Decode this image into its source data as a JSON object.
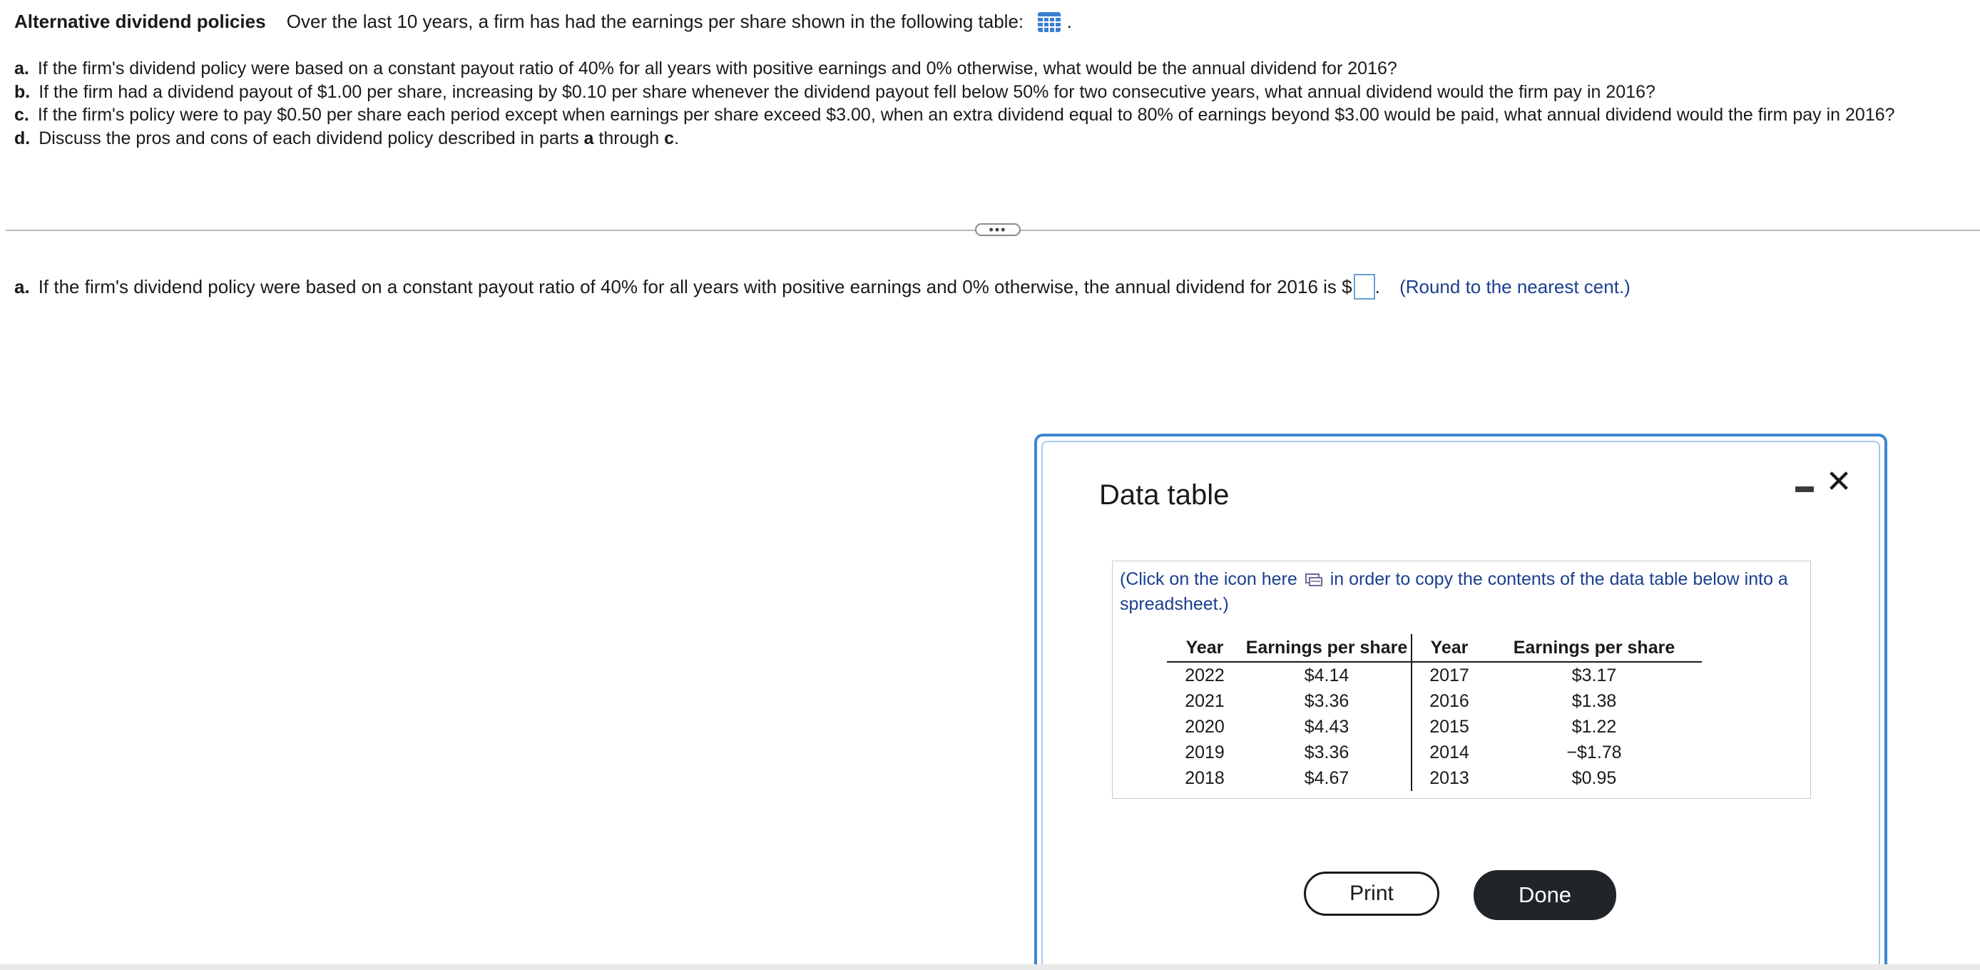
{
  "header": {
    "title": "Alternative dividend policies",
    "intro": "Over the last 10 years, a firm has had the earnings per share shown in the following table:",
    "trailing": "."
  },
  "questions": [
    {
      "letter": "a.",
      "text": "If the firm's dividend policy were based on a constant payout ratio of 40% for all years with positive earnings and 0% otherwise, what would be the annual dividend for 2016?"
    },
    {
      "letter": "b.",
      "text": "If the firm had a dividend payout of $1.00 per share, increasing by $0.10 per share whenever the dividend payout fell below 50% for two consecutive years, what annual dividend would the firm pay in 2016?"
    },
    {
      "letter": "c.",
      "text": "If the firm's policy were to pay $0.50 per share each period except when earnings per share exceed $3.00, when an extra dividend equal to 80% of earnings beyond $3.00 would be paid, what annual dividend would the firm pay in 2016?"
    },
    {
      "letter": "d.",
      "text_before": "Discuss the pros and cons of each dividend policy described in parts",
      "bold1": "a",
      "text_mid": "through",
      "bold2": "c",
      "text_after": "."
    }
  ],
  "expand_button": "•••",
  "answer": {
    "letter": "a.",
    "text": "If the firm's dividend policy were based on a constant payout ratio of 40% for all years with positive earnings and 0% otherwise, the annual dividend for 2016 is $",
    "value": "",
    "after": ".",
    "note": "(Round to the nearest cent.)"
  },
  "modal": {
    "title": "Data table",
    "copy_note_before": "(Click on the icon here",
    "copy_note_after": "in order to copy the contents of the data table below into a spreadsheet.)",
    "headers": [
      "Year",
      "Earnings per share",
      "Year",
      "Earnings per share"
    ],
    "rows": [
      [
        "2022",
        "$4.14",
        "2017",
        "$3.17"
      ],
      [
        "2021",
        "$3.36",
        "2016",
        "$1.38"
      ],
      [
        "2020",
        "$4.43",
        "2015",
        "$1.22"
      ],
      [
        "2019",
        "$3.36",
        "2014",
        "−$1.78"
      ],
      [
        "2018",
        "$4.67",
        "2013",
        "$0.95"
      ]
    ],
    "print_label": "Print",
    "done_label": "Done",
    "close_glyph": "✕"
  },
  "colors": {
    "accent": "#3e86d2",
    "link_text": "#1b3f8f",
    "done_bg": "#212529"
  },
  "icons": {
    "table": "table-grid-icon",
    "copy": "copy-to-spreadsheet-icon",
    "minimize": "minimize-icon",
    "close": "close-icon"
  }
}
